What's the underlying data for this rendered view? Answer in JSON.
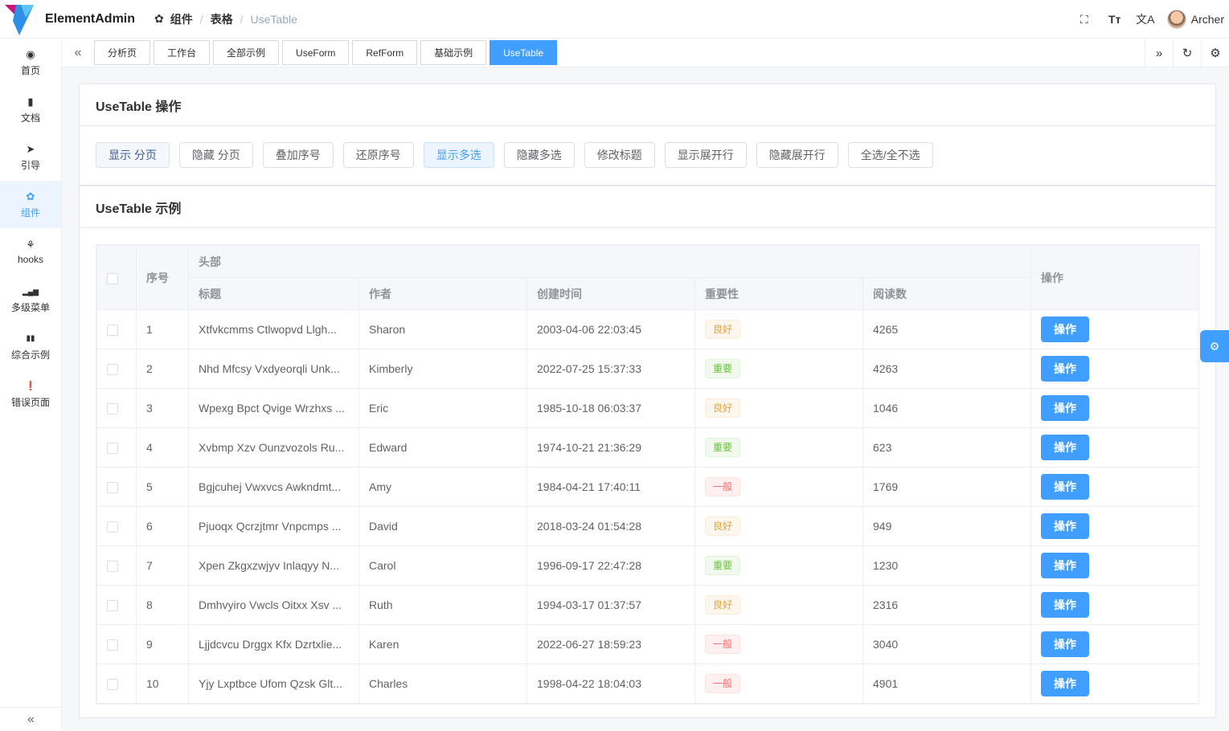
{
  "header": {
    "brand": "ElementAdmin",
    "breadcrumb": [
      "组件",
      "表格",
      "UseTable"
    ],
    "user": "Archer",
    "icons": [
      "fullscreen-icon",
      "font-size-icon",
      "translate-icon"
    ]
  },
  "sidebar": {
    "items": [
      {
        "label": "首页",
        "icon": "dashboard-icon",
        "glyph": "◉"
      },
      {
        "label": "文档",
        "icon": "document-icon",
        "glyph": "▮"
      },
      {
        "label": "引导",
        "icon": "paper-plane-icon",
        "glyph": "➤"
      },
      {
        "label": "组件",
        "icon": "components-icon",
        "glyph": "✿"
      },
      {
        "label": "hooks",
        "icon": "webhook-icon",
        "glyph": "⚘"
      },
      {
        "label": "多级菜单",
        "icon": "bar-chart-icon",
        "glyph": "▂▄▆"
      },
      {
        "label": "综合示例",
        "icon": "library-icon",
        "glyph": "▮▮"
      },
      {
        "label": "错误页面",
        "icon": "error-icon",
        "glyph": "❗"
      }
    ],
    "collapse_glyph": "«"
  },
  "tags": [
    "分析页",
    "工作台",
    "全部示例",
    "UseForm",
    "RefForm",
    "基础示例",
    "UseTable"
  ],
  "tagsbar": {
    "left_glyph": "«",
    "right_glyph": "»",
    "refresh_glyph": "↻",
    "settings_glyph": "⚙"
  },
  "ops_card": {
    "title": "UseTable 操作",
    "buttons": [
      "显示 分页",
      "隐藏 分页",
      "叠加序号",
      "还原序号",
      "显示多选",
      "隐藏多选",
      "修改标题",
      "显示展开行",
      "隐藏展开行",
      "全选/全不选"
    ]
  },
  "table_card": {
    "title": "UseTable 示例",
    "headers": {
      "index": "序号",
      "group": "头部",
      "title": "标题",
      "author": "作者",
      "time": "创建时间",
      "importance": "重要性",
      "reads": "阅读数",
      "action": "操作"
    },
    "rows": [
      {
        "index": "1",
        "title": "Xtfvkcmms Ctlwopvd Llgh...",
        "author": "Sharon",
        "time": "2003-04-06 22:03:45",
        "importance": "良好",
        "level": "good",
        "reads": "4265",
        "action": "操作"
      },
      {
        "index": "2",
        "title": "Nhd Mfcsy Vxdyeorqli Unk...",
        "author": "Kimberly",
        "time": "2022-07-25 15:37:33",
        "importance": "重要",
        "level": "imp",
        "reads": "4263",
        "action": "操作"
      },
      {
        "index": "3",
        "title": "Wpexg Bpct Qvige Wrzhxs ...",
        "author": "Eric",
        "time": "1985-10-18 06:03:37",
        "importance": "良好",
        "level": "good",
        "reads": "1046",
        "action": "操作"
      },
      {
        "index": "4",
        "title": "Xvbmp Xzv Ounzvozols Ru...",
        "author": "Edward",
        "time": "1974-10-21 21:36:29",
        "importance": "重要",
        "level": "imp",
        "reads": "623",
        "action": "操作"
      },
      {
        "index": "5",
        "title": "Bgjcuhej Vwxvcs Awkndmt...",
        "author": "Amy",
        "time": "1984-04-21 17:40:11",
        "importance": "一般",
        "level": "gen",
        "reads": "1769",
        "action": "操作"
      },
      {
        "index": "6",
        "title": "Pjuoqx Qcrzjtmr Vnpcmps ...",
        "author": "David",
        "time": "2018-03-24 01:54:28",
        "importance": "良好",
        "level": "good",
        "reads": "949",
        "action": "操作"
      },
      {
        "index": "7",
        "title": "Xpen Zkgxzwjyv Inlaqyy N...",
        "author": "Carol",
        "time": "1996-09-17 22:47:28",
        "importance": "重要",
        "level": "imp",
        "reads": "1230",
        "action": "操作"
      },
      {
        "index": "8",
        "title": "Dmhvyiro Vwcls Oitxx Xsv ...",
        "author": "Ruth",
        "time": "1994-03-17 01:37:57",
        "importance": "良好",
        "level": "good",
        "reads": "2316",
        "action": "操作"
      },
      {
        "index": "9",
        "title": "Ljjdcvcu Drggx Kfx Dzrtxlie...",
        "author": "Karen",
        "time": "2022-06-27 18:59:23",
        "importance": "一般",
        "level": "gen",
        "reads": "3040",
        "action": "操作"
      },
      {
        "index": "10",
        "title": "Yjy Lxptbce Ufom Qzsk Glt...",
        "author": "Charles",
        "time": "1998-04-22 18:04:03",
        "importance": "一般",
        "level": "gen",
        "reads": "4901",
        "action": "操作"
      }
    ]
  },
  "colors": {
    "primary": "#409eff",
    "good": "#e6a23c",
    "important": "#67c23a",
    "general": "#f56c6c"
  }
}
